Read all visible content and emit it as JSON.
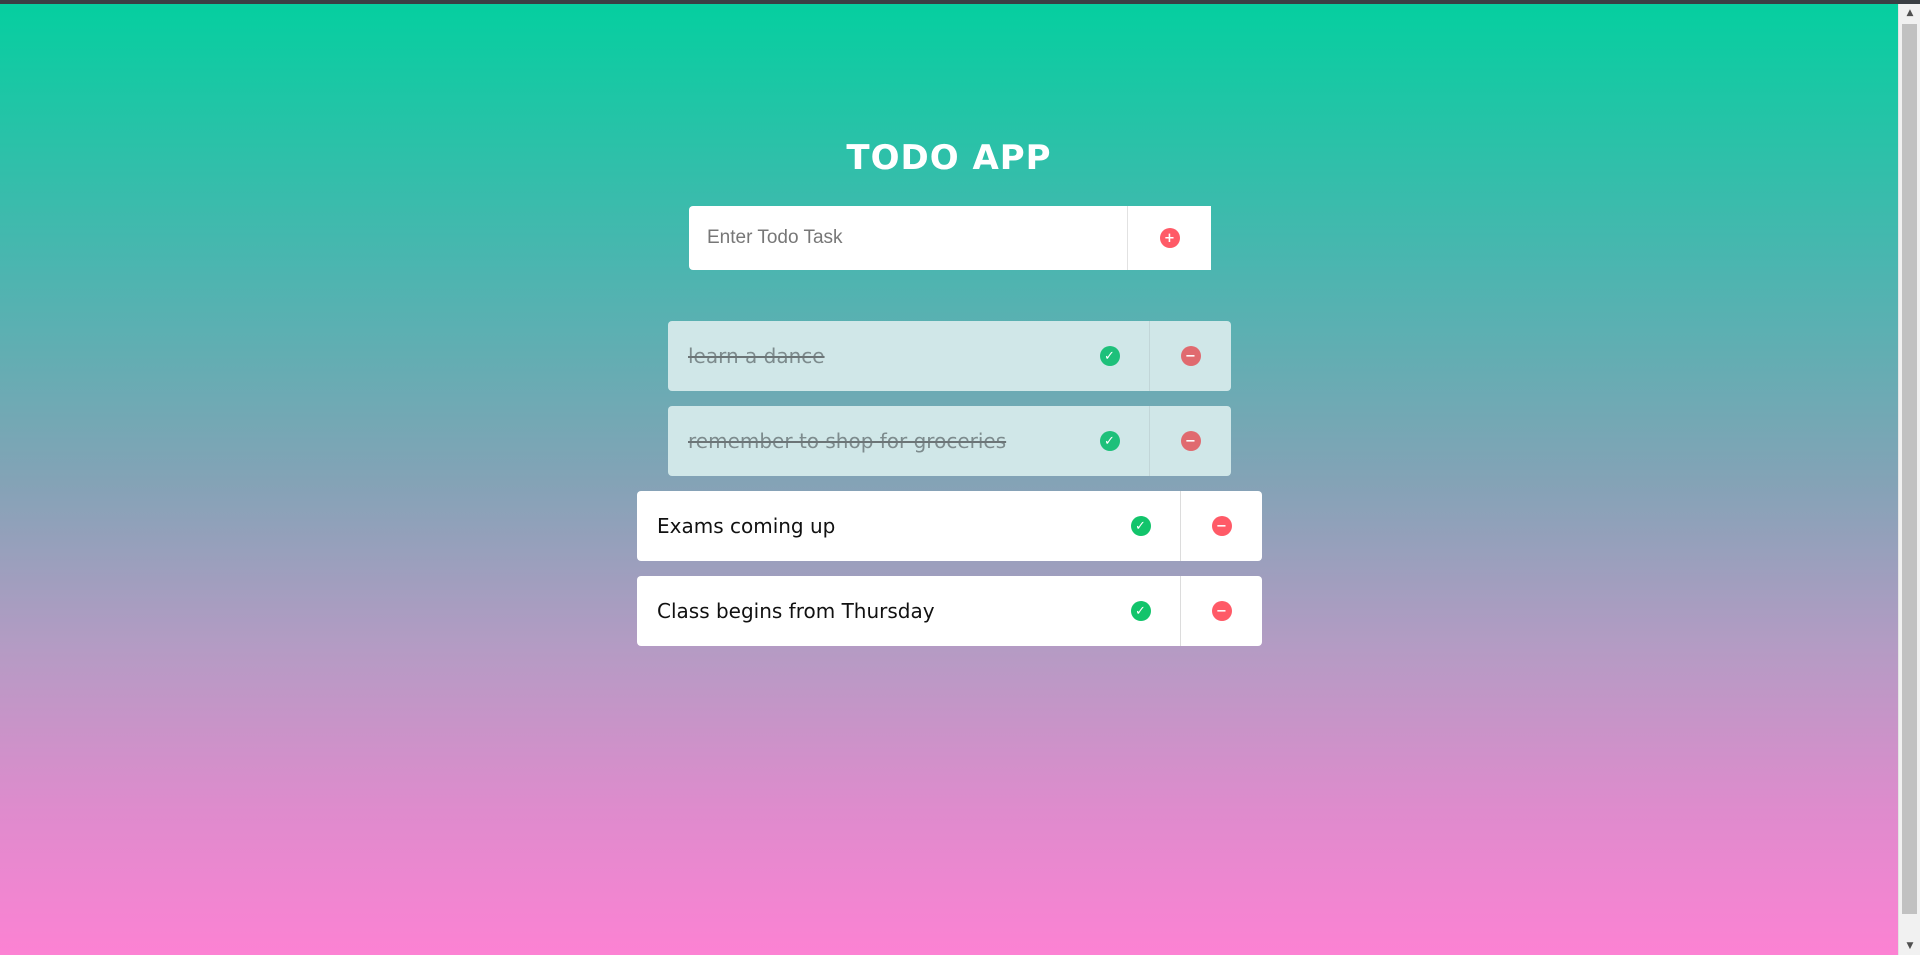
{
  "app": {
    "title": "TODO APP"
  },
  "form": {
    "placeholder": "Enter Todo Task",
    "value": "",
    "add_icon": "plus-circle-icon"
  },
  "todos": [
    {
      "text": "learn a dance",
      "completed": true
    },
    {
      "text": "remember to shop for groceries",
      "completed": true
    },
    {
      "text": "Exams coming up",
      "completed": false
    },
    {
      "text": "Class begins from Thursday",
      "completed": false
    }
  ],
  "icons": {
    "check": "check-circle-icon",
    "remove": "minus-circle-icon",
    "add": "plus-circle-icon"
  },
  "colors": {
    "gradient_top": "#05cfa0",
    "gradient_bottom": "#fc82d3",
    "check": "#12c46b",
    "remove": "#ff5a67",
    "completed_bg": "#d0e7e8",
    "title": "#ffffff"
  }
}
